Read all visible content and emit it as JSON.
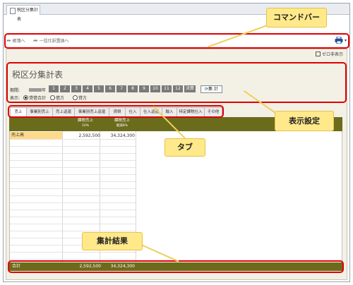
{
  "document_tab": {
    "label": "税区分集計表"
  },
  "command_bar": {
    "prev_label": "帳簿へ",
    "next_label": "一括仕訳置換へ",
    "printer_icon": "printer-icon"
  },
  "options": {
    "zero_display_label": "ゼロ非表示"
  },
  "report": {
    "title": "税区分集計表",
    "period_label": "期間:",
    "year_suffix": "年",
    "months": [
      "1",
      "2",
      "3",
      "4",
      "5",
      "6",
      "7",
      "8",
      "9",
      "10",
      "11",
      "12",
      "決算"
    ],
    "calc_label": "集 計",
    "display_label": "表示:",
    "display_options": [
      {
        "label": "貸借合計",
        "selected": true
      },
      {
        "label": "借方",
        "selected": false
      },
      {
        "label": "貸方",
        "selected": false
      }
    ]
  },
  "tabs": [
    "売上",
    "事業別売上",
    "売上返還",
    "事業別売上返還",
    "貸倒",
    "仕入",
    "仕入返還",
    "輸入",
    "特定課税仕入",
    "その他"
  ],
  "grid": {
    "header": [
      {
        "line1": "課税売上",
        "line2": "10%"
      },
      {
        "line1": "課税売上",
        "line2": "軽減8%"
      }
    ],
    "rows": [
      {
        "label": "売上高",
        "v1": "2,592,500",
        "v2": "34,324,300"
      }
    ],
    "total": {
      "label": "合計",
      "v1": "2,592,500",
      "v2": "34,324,300"
    }
  },
  "callouts": {
    "command_bar": "コマンドバー",
    "display_settings": "表示設定",
    "tabs": "タブ",
    "totals": "集計結果"
  },
  "colors": {
    "header_bg": "#6b6b1c",
    "highlight_row": "#ffd98a",
    "outline": "#e00000",
    "callout": "#ffe98a"
  }
}
